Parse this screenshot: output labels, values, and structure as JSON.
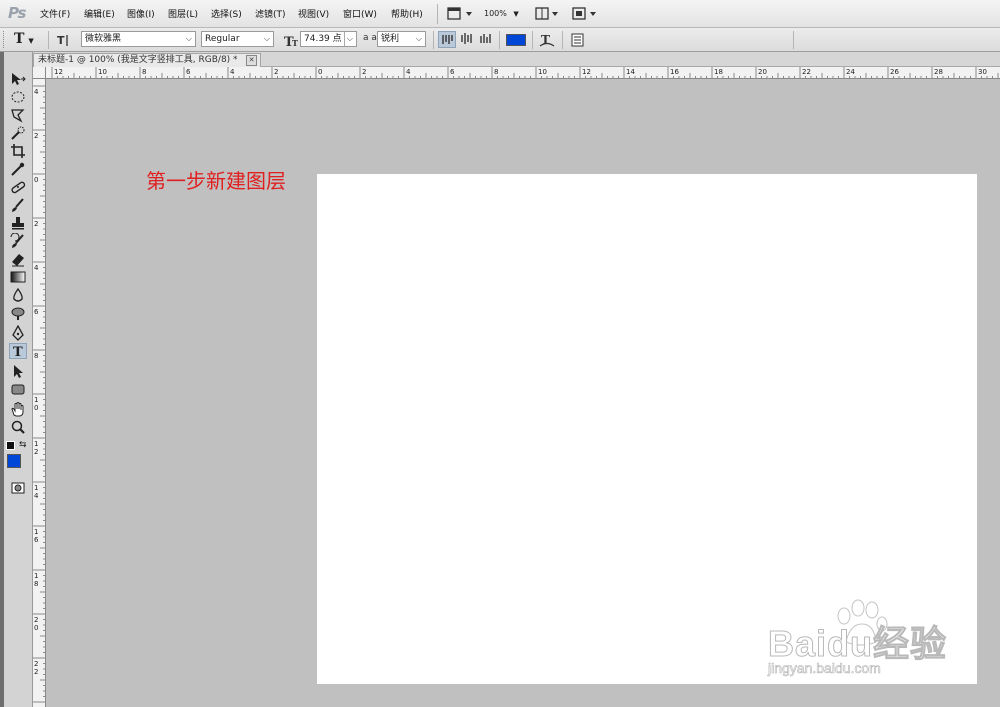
{
  "app": {
    "logo": "Ps"
  },
  "menus": [
    "文件(F)",
    "编辑(E)",
    "图像(I)",
    "图层(L)",
    "选择(S)",
    "滤镜(T)",
    "视图(V)",
    "窗口(W)",
    "帮助(H)"
  ],
  "menubar": {
    "zoom": "100%"
  },
  "options": {
    "tool_glyph": "T",
    "font_family": "微软雅黑",
    "font_style": "Regular",
    "font_size": "74.39 点",
    "aa_label": "a a",
    "antialias": "锐利",
    "text_color": "#0047d8"
  },
  "document": {
    "tab_title": "未标题-1 @ 100% (我是文字竖排工具, RGB/8) *",
    "close_glyph": "✕"
  },
  "ruler_top": [
    "12",
    "10",
    "8",
    "6",
    "4",
    "2",
    "0",
    "2",
    "4",
    "6",
    "8",
    "10",
    "12",
    "14",
    "16",
    "18",
    "20",
    "22",
    "24",
    "26",
    "28",
    "30"
  ],
  "ruler_left": [
    "4",
    "2",
    "0",
    "2",
    "4",
    "6",
    "8",
    "10",
    "12",
    "14",
    "16",
    "18",
    "20",
    "22"
  ],
  "annotation": "第一步新建图层",
  "watermark": {
    "brand": "Baidu经验",
    "url": "jingyan.baidu.com"
  },
  "toolbar": {
    "tools": [
      "move-tool",
      "marquee-tool",
      "lasso-tool",
      "quick-select-tool",
      "crop-tool",
      "eyedropper-tool",
      "healing-brush-tool",
      "brush-tool",
      "clone-stamp-tool",
      "history-brush-tool",
      "eraser-tool",
      "gradient-tool",
      "blur-tool",
      "dodge-tool",
      "pen-tool",
      "type-tool",
      "path-select-tool",
      "shape-tool",
      "hand-tool",
      "zoom-tool"
    ],
    "active_tool": "type-tool",
    "foreground_color": "#0047d8"
  }
}
